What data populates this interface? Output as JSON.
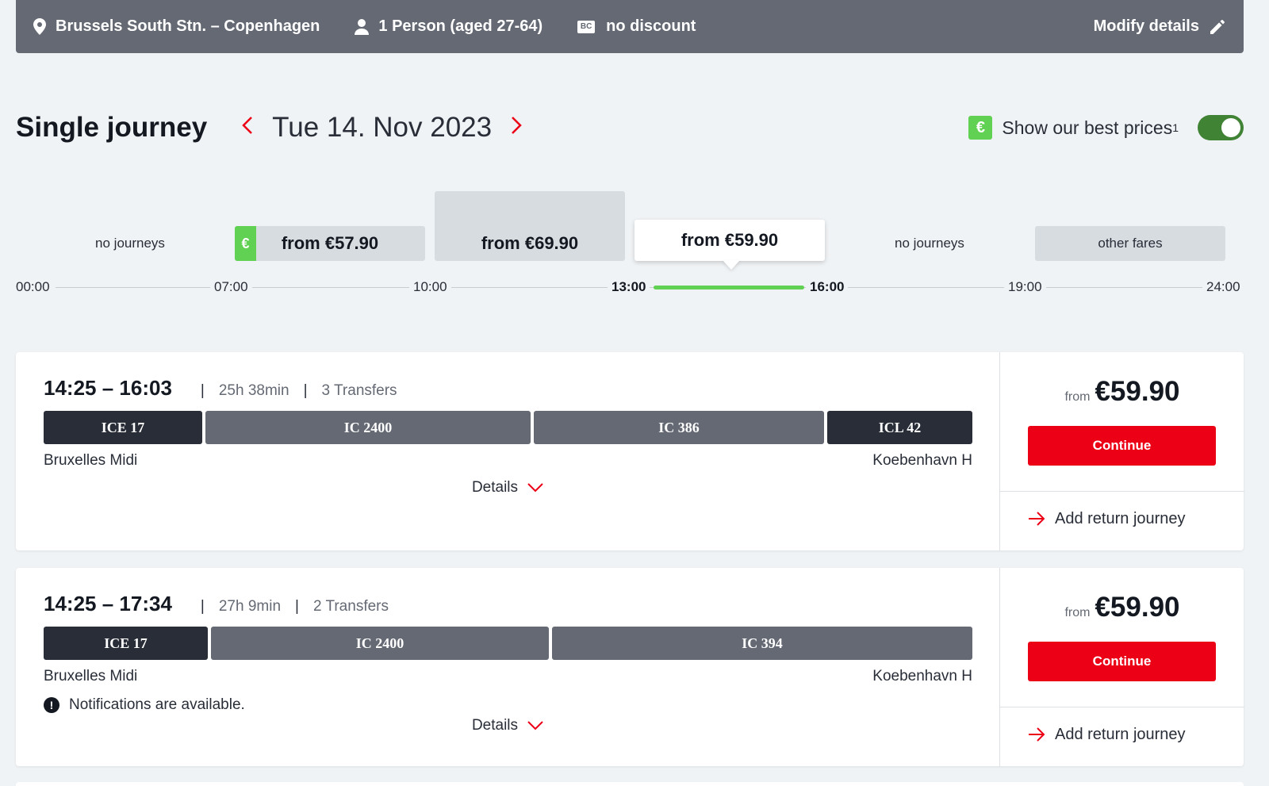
{
  "topbar": {
    "route": "Brussels South Stn. – Copenhagen",
    "passengers": "1 Person (aged 27-64)",
    "discount_badge": "BC",
    "discount": "no discount",
    "modify_label": "Modify details"
  },
  "heading": {
    "title": "Single journey",
    "date": "Tue 14. Nov 2023",
    "best_prices_badge": "€",
    "best_prices_label": "Show our best prices",
    "best_prices_sup": "1",
    "best_prices_enabled": true
  },
  "timeline": {
    "slots": [
      {
        "label": "no journeys"
      },
      {
        "badge": "€",
        "label": "from €57.90"
      },
      {
        "label": "from €69.90"
      },
      {
        "label": "from €59.90",
        "selected": true
      },
      {
        "label": "no journeys"
      },
      {
        "label": "other fares"
      }
    ],
    "ticks": [
      "00:00",
      "07:00",
      "10:00",
      "13:00",
      "16:00",
      "19:00",
      "24:00"
    ]
  },
  "journeys": [
    {
      "time": "14:25 – 16:03",
      "duration": "25h 38min",
      "transfers": "3 Transfers",
      "segments": [
        "ICE 17",
        "IC 2400",
        "IC 386",
        "ICL 42"
      ],
      "origin": "Bruxelles Midi",
      "destination": "Koebenhavn H",
      "details_label": "Details",
      "price_prefix": "from",
      "price": "€59.90",
      "continue_label": "Continue",
      "return_label": "Add return journey"
    },
    {
      "time": "14:25 – 17:34",
      "duration": "27h 9min",
      "transfers": "2 Transfers",
      "segments": [
        "ICE 17",
        "IC 2400",
        "IC 394"
      ],
      "origin": "Bruxelles Midi",
      "destination": "Koebenhavn H",
      "notice_icon": "!",
      "notice": "Notifications are available.",
      "details_label": "Details",
      "price_prefix": "from",
      "price": "€59.90",
      "continue_label": "Continue",
      "return_label": "Add return journey"
    }
  ],
  "colors": {
    "brand_red": "#ec0016",
    "best_green": "#60d152",
    "toggle_green": "#408335",
    "topbar_grey": "#646973",
    "segment_dark": "#282d37",
    "segment_mid": "#646973"
  }
}
